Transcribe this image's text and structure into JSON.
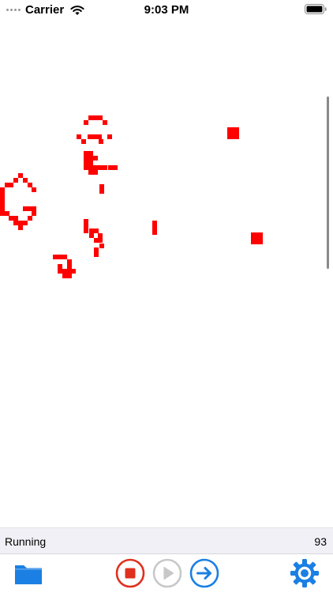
{
  "status_bar": {
    "carrier": "Carrier",
    "time": "9:03 PM",
    "signal_icon": "signal-dots-icon",
    "wifi_icon": "wifi-icon",
    "battery_icon": "battery-icon"
  },
  "board": {
    "cell_color": "#ff0000",
    "live_cells": [
      [
        112,
        146
      ],
      [
        118,
        146
      ],
      [
        124,
        146
      ],
      [
        106,
        152
      ],
      [
        130,
        152
      ],
      [
        97,
        170
      ],
      [
        111,
        170
      ],
      [
        117,
        170
      ],
      [
        123,
        170
      ],
      [
        136,
        170
      ],
      [
        103,
        176
      ],
      [
        125,
        176
      ],
      [
        106,
        191
      ],
      [
        112,
        191
      ],
      [
        106,
        197
      ],
      [
        112,
        197
      ],
      [
        118,
        197
      ],
      [
        106,
        203
      ],
      [
        112,
        203
      ],
      [
        106,
        209
      ],
      [
        112,
        209
      ],
      [
        118,
        209
      ],
      [
        124,
        209
      ],
      [
        130,
        209
      ],
      [
        137,
        209
      ],
      [
        143,
        209
      ],
      [
        112,
        215
      ],
      [
        118,
        215
      ],
      [
        126,
        233
      ],
      [
        126,
        239
      ],
      [
        23,
        219
      ],
      [
        17,
        225
      ],
      [
        29,
        225
      ],
      [
        6,
        231
      ],
      [
        11,
        231
      ],
      [
        35,
        231
      ],
      [
        0,
        237
      ],
      [
        40,
        237
      ],
      [
        0,
        243
      ],
      [
        0,
        249
      ],
      [
        0,
        255
      ],
      [
        0,
        261
      ],
      [
        29,
        261
      ],
      [
        35,
        261
      ],
      [
        40,
        261
      ],
      [
        0,
        267
      ],
      [
        6,
        267
      ],
      [
        40,
        267
      ],
      [
        11,
        273
      ],
      [
        17,
        273
      ],
      [
        35,
        273
      ],
      [
        17,
        279
      ],
      [
        23,
        279
      ],
      [
        29,
        279
      ],
      [
        23,
        285
      ],
      [
        106,
        277
      ],
      [
        106,
        283
      ],
      [
        106,
        289
      ],
      [
        113,
        289
      ],
      [
        119,
        289
      ],
      [
        113,
        295
      ],
      [
        124,
        295
      ],
      [
        119,
        301
      ],
      [
        124,
        301
      ],
      [
        126,
        308
      ],
      [
        119,
        313
      ],
      [
        119,
        319
      ],
      [
        193,
        279
      ],
      [
        193,
        285
      ],
      [
        193,
        291
      ],
      [
        67,
        322
      ],
      [
        73,
        322
      ],
      [
        79,
        322
      ],
      [
        85,
        328
      ],
      [
        73,
        334
      ],
      [
        85,
        334
      ],
      [
        73,
        340
      ],
      [
        79,
        340
      ],
      [
        85,
        340
      ],
      [
        90,
        340
      ],
      [
        79,
        346
      ],
      [
        85,
        346
      ]
    ],
    "large_cells": [
      [
        288,
        161
      ],
      [
        318,
        294
      ]
    ]
  },
  "info_bar": {
    "status": "Running",
    "generation": "93"
  },
  "toolbar": {
    "accent_color": "#1b7fe3",
    "stop_color": "#e1301f",
    "disabled_color": "#c8c8c8",
    "buttons": [
      {
        "name": "folder-button",
        "icon": "folder-icon"
      },
      {
        "name": "stop-button",
        "icon": "stop-icon"
      },
      {
        "name": "play-button",
        "icon": "play-icon"
      },
      {
        "name": "step-button",
        "icon": "arrow-right-icon"
      },
      {
        "name": "settings-button",
        "icon": "gear-icon"
      }
    ]
  }
}
